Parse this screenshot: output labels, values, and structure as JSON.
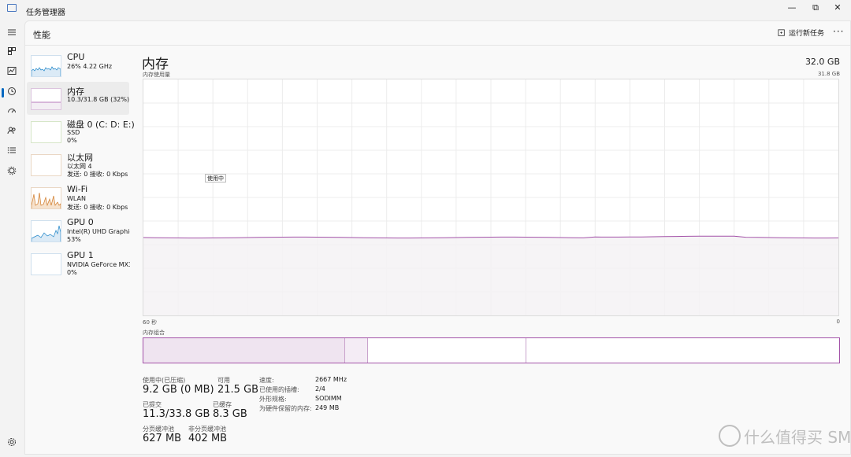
{
  "window": {
    "title": "任务管理器",
    "controls": {
      "minimize": "—",
      "restore": "⧉",
      "close": "✕"
    }
  },
  "rail": {
    "icons": [
      "menu-icon",
      "processes-icon",
      "performance-icon",
      "app-history-icon",
      "startup-icon",
      "users-icon",
      "details-icon",
      "services-icon",
      "settings-icon"
    ]
  },
  "header": {
    "title": "性能",
    "run_task_label": "运行新任务",
    "more_label": "···"
  },
  "devices": [
    {
      "name": "CPU",
      "line1": "26% 4.22 GHz",
      "line2": ""
    },
    {
      "name": "内存",
      "line1": "10.3/31.8 GB (32%)",
      "line2": ""
    },
    {
      "name": "磁盘 0 (C: D: E:)",
      "line1": "SSD",
      "line2": "0%"
    },
    {
      "name": "以太网",
      "line1": "以太网 4",
      "line2": "发送: 0 接收: 0 Kbps"
    },
    {
      "name": "Wi-Fi",
      "line1": "WLAN",
      "line2": "发送: 0 接收: 0 Kbps"
    },
    {
      "name": "GPU 0",
      "line1": "Intel(R) UHD Graphics",
      "line2": "53%"
    },
    {
      "name": "GPU 1",
      "line1": "NVIDIA GeForce MX3",
      "line2": "0%"
    }
  ],
  "memory": {
    "title": "内存",
    "total": "32.0 GB",
    "graph_label": "内存使用量",
    "graph_max": "31.8 GB",
    "tooltip": "使用中",
    "axis_left": "60 秒",
    "axis_right": "0",
    "composition_label": "内存组合",
    "usage_fraction": 0.33,
    "composition_fractions": {
      "in_use": 0.29,
      "modified": 0.033,
      "standby": 0.228,
      "free": 0.449
    },
    "stats": {
      "in_use_label": "使用中(已压缩)",
      "in_use_value": "9.2 GB (0 MB)",
      "available_label": "可用",
      "available_value": "21.5 GB",
      "committed_label": "已提交",
      "committed_value": "11.3/33.8 GB",
      "cached_label": "已缓存",
      "cached_value": "8.3 GB",
      "paged_label": "分页缓冲池",
      "paged_value": "627 MB",
      "nonpaged_label": "非分页缓冲池",
      "nonpaged_value": "402 MB"
    },
    "specs": {
      "speed_label": "速度:",
      "speed_value": "2667 MHz",
      "slots_label": "已使用的插槽:",
      "slots_value": "2/4",
      "form_label": "外形规格:",
      "form_value": "SODIMM",
      "reserved_label": "为硬件保留的内存:",
      "reserved_value": "249 MB"
    }
  },
  "colors": {
    "accent": "#0067c0",
    "memory_line": "#a352a8",
    "memory_fill": "#f4f2f4",
    "cpu_line": "#1e85c8"
  },
  "watermark": "什么值得买 SMYZ.NET"
}
